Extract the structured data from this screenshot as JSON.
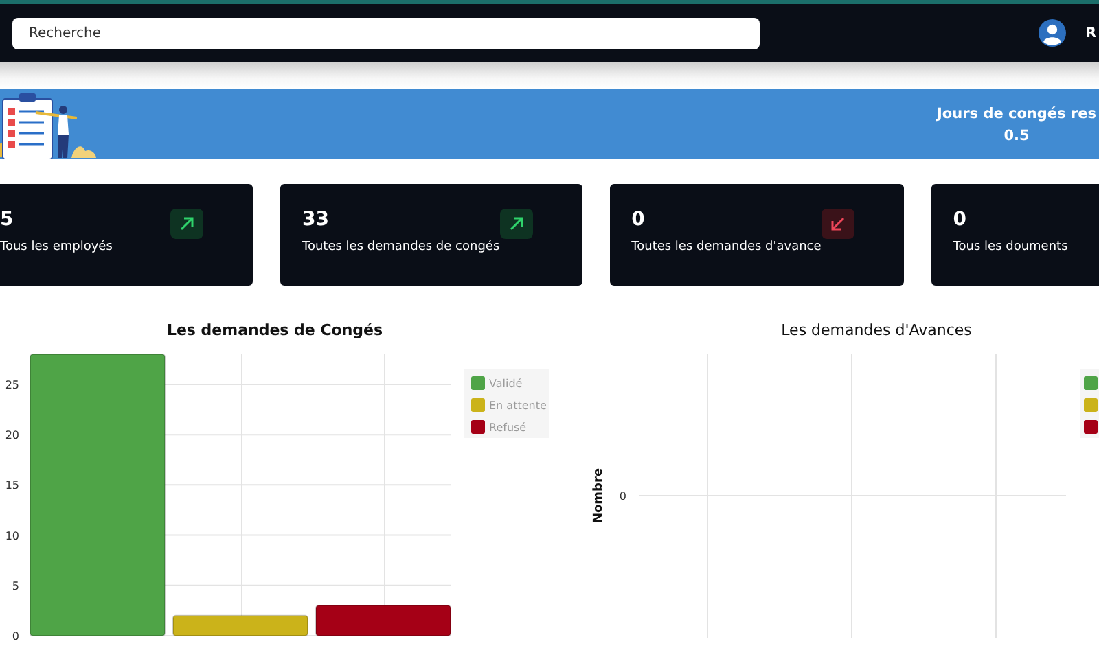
{
  "header": {
    "search": {
      "placeholder": "Recherche"
    },
    "user_name": "R"
  },
  "banner": {
    "title": "Jours de congés res",
    "value": "0.5"
  },
  "cards": [
    {
      "value": "5",
      "label": "Tous les employés",
      "kind": "rising"
    },
    {
      "value": "33",
      "label": "Toutes les demandes de congés",
      "kind": "rising"
    },
    {
      "value": "0",
      "label": "Toutes les demandes d'avance",
      "kind": "falling"
    },
    {
      "value": "0",
      "label": "Tous les douments",
      "kind": "plain"
    }
  ],
  "leave_chart": {
    "chart_data": {
      "type": "bar",
      "title": "Les demandes de Congés",
      "ylim": [
        0,
        28
      ],
      "grid": true,
      "legend": true,
      "yticks": [
        0,
        5,
        10,
        15,
        20,
        25
      ],
      "series": [
        {
          "name": "Validé",
          "color": "#4fa447",
          "values": [
            28
          ]
        },
        {
          "name": "En attente",
          "color": "#cbb31a",
          "values": [
            2
          ]
        },
        {
          "name": "Refusé",
          "color": "#a50016",
          "values": [
            3
          ]
        }
      ]
    }
  },
  "advance_chart": {
    "title": "Les demandes d'Avances",
    "ylabel": "Nombre",
    "ytick_labels": [
      "0"
    ],
    "legend": [
      {
        "color": "#4fa447"
      },
      {
        "color": "#cbb31a"
      },
      {
        "color": "#a50016"
      }
    ]
  }
}
